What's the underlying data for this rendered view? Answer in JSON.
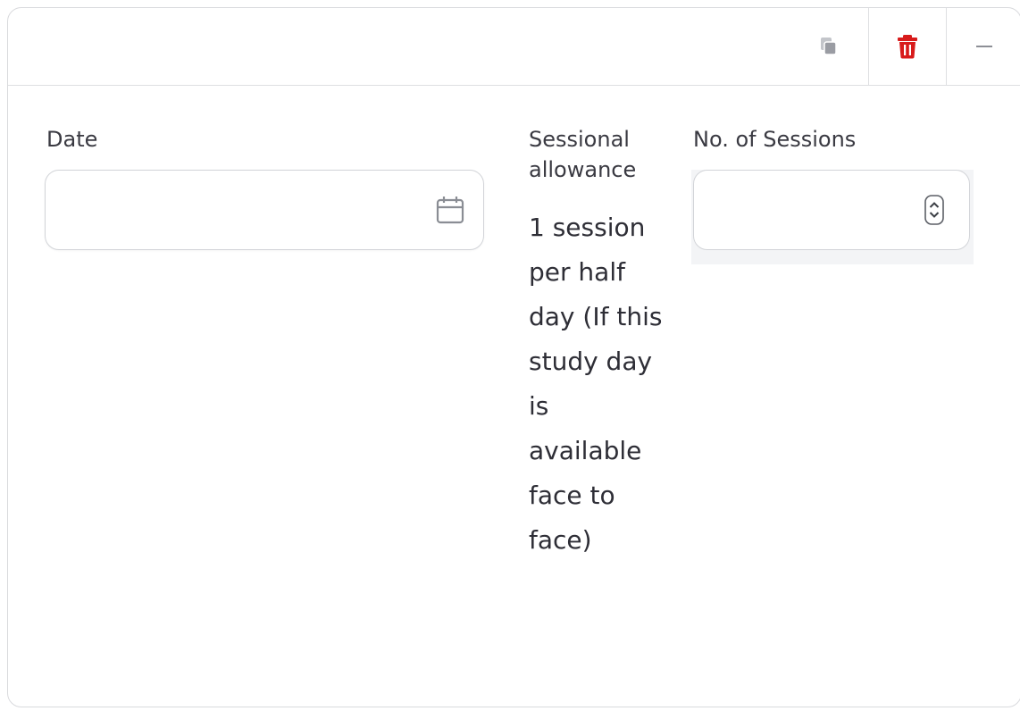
{
  "toolbar": {
    "copy_icon": "copy-icon",
    "delete_icon": "trash-icon",
    "collapse_icon": "minus-icon",
    "delete_color": "#d81b1b"
  },
  "form": {
    "date_label": "Date",
    "date_value": "",
    "sessional_label": "Sessional allowance",
    "sessional_text": "1 session per half day (If this study day is available face to face)",
    "sessions_label": "No. of Sessions",
    "sessions_value": ""
  }
}
